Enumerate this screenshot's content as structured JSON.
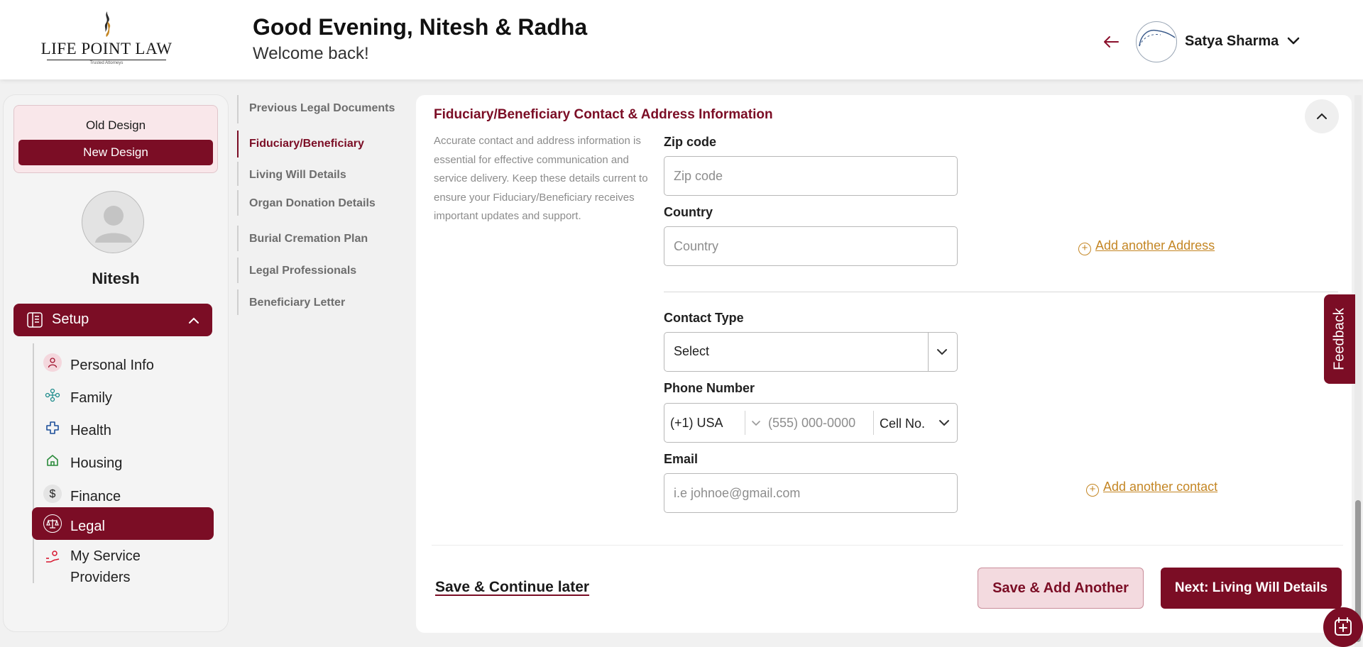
{
  "header": {
    "logo_text": "LIFE POINT LAW",
    "logo_tagline": "Trusted Attorneys",
    "greeting": "Good Evening, Nitesh & Radha",
    "subtitle": "Welcome back!",
    "user_name": "Satya Sharma"
  },
  "sidebar": {
    "old_design": "Old Design",
    "new_design": "New Design",
    "profile_name": "Nitesh",
    "setup_label": "Setup",
    "items": [
      {
        "label": "Personal Info",
        "icon": "person-icon"
      },
      {
        "label": "Family",
        "icon": "family-icon"
      },
      {
        "label": "Health",
        "icon": "health-cross-icon"
      },
      {
        "label": "Housing",
        "icon": "house-icon"
      },
      {
        "label": "Finance",
        "icon": "dollar-icon"
      },
      {
        "label": "Legal",
        "icon": "scales-icon",
        "active": true
      },
      {
        "label": "My Service Providers",
        "icon": "service-provider-icon"
      }
    ]
  },
  "subnav": {
    "items": [
      {
        "label": "Previous Legal Documents"
      },
      {
        "label": "Fiduciary/Beneficiary",
        "active": true
      },
      {
        "label": "Living Will Details"
      },
      {
        "label": "Organ Donation Details"
      },
      {
        "label": "Burial Cremation Plan"
      },
      {
        "label": "Legal Professionals"
      },
      {
        "label": "Beneficiary Letter"
      }
    ]
  },
  "main": {
    "section_title": "Fiduciary/Beneficiary Contact & Address Information",
    "description": "Accurate contact and address information is essential for effective communication and service delivery. Keep these details current to ensure your Fiduciary/Beneficiary receives important updates and support.",
    "zip": {
      "label": "Zip code",
      "placeholder": "Zip code"
    },
    "country": {
      "label": "Country",
      "placeholder": "Country"
    },
    "add_address": "Add another Address",
    "contact_type": {
      "label": "Contact Type",
      "value": "Select"
    },
    "phone": {
      "label": "Phone Number",
      "country_code": "(+1) USA",
      "placeholder": "(555) 000-0000",
      "type": "Cell No."
    },
    "email": {
      "label": "Email",
      "placeholder": "i.e johnoe@gmail.com"
    },
    "add_contact": "Add another contact",
    "save_later": "Save & Continue later",
    "save_add": "Save & Add Another",
    "next": "Next: Living Will Details"
  },
  "feedback_label": "Feedback",
  "colors": {
    "brand": "#7b0d25",
    "accent_link": "#c48624",
    "brand_light": "#f3dadf"
  }
}
